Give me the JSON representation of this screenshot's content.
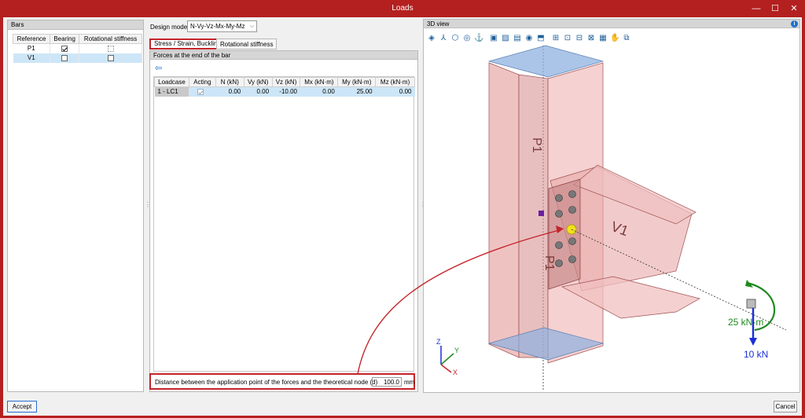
{
  "window": {
    "title": "Loads",
    "minimize_glyph": "—",
    "maximize_glyph": "☐",
    "close_glyph": "✕"
  },
  "bars_panel": {
    "title": "Bars",
    "columns": [
      "Reference",
      "Bearing",
      "Rotational stiffness"
    ],
    "rows": [
      {
        "reference": "P1",
        "bearing": true,
        "rotational_stiffness": false,
        "selected": false
      },
      {
        "reference": "V1",
        "bearing": false,
        "rotational_stiffness": false,
        "selected": true
      }
    ]
  },
  "design_model": {
    "label": "Design model",
    "value": "N-Vy-Vz-Mx-My-Mz",
    "arrow": "⌵"
  },
  "tabs": [
    {
      "label": "Stress / Strain, Buckling",
      "active": true
    },
    {
      "label": "Rotational stiffness",
      "active": false
    }
  ],
  "forces_panel": {
    "title": "Forces at the end of the bar",
    "back_glyph": "⇦",
    "columns": [
      "Loadcase",
      "Acting",
      "N (kN)",
      "Vy (kN)",
      "Vz (kN)",
      "Mx (kN·m)",
      "My (kN·m)",
      "Mz (kN·m)"
    ],
    "rows": [
      {
        "loadcase": "1 - LC1",
        "acting": true,
        "n": "0.00",
        "vy": "0.00",
        "vz": "-10.00",
        "mx": "0.00",
        "my": "25.00",
        "mz": "0.00"
      }
    ]
  },
  "distance": {
    "label": "Distance between the application point of the forces and the theoretical node (d)",
    "value": "100.0",
    "unit": "mm"
  },
  "view3d": {
    "title": "3D view",
    "info_glyph": "i",
    "toolbar_icons": [
      "layers-icon",
      "axes-icon",
      "cube-icon",
      "weld-icon",
      "anchor-icon",
      "palette-icon",
      "edit-icon",
      "plate-icon",
      "bolt-icon",
      "stiffener-icon",
      "view-front-icon",
      "view-side-icon",
      "view-top-icon",
      "view-iso-icon",
      "grid-icon",
      "pan-icon",
      "zoom-window-icon"
    ],
    "toolbar_glyphs": [
      "◈",
      "⅄",
      "⬡",
      "◎",
      "⚓",
      "▣",
      "▨",
      "▤",
      "◉",
      "⬒",
      "⊞",
      "⊡",
      "⊟",
      "⊠",
      "▦",
      "✋",
      "⧉"
    ],
    "labels": {
      "column": "P1",
      "beam": "V1",
      "moment": "25 kN·m",
      "force": "10 kN"
    },
    "axes": {
      "z": "Z",
      "y": "Y",
      "x": "X"
    },
    "colors": {
      "steel": "#e8a8a8",
      "plate": "#8fb1e0",
      "highlight": "#c4242a",
      "moment": "#1f8a1f",
      "force": "#1a2fd6"
    }
  },
  "buttons": {
    "accept": "Accept",
    "cancel": "Cancel"
  }
}
